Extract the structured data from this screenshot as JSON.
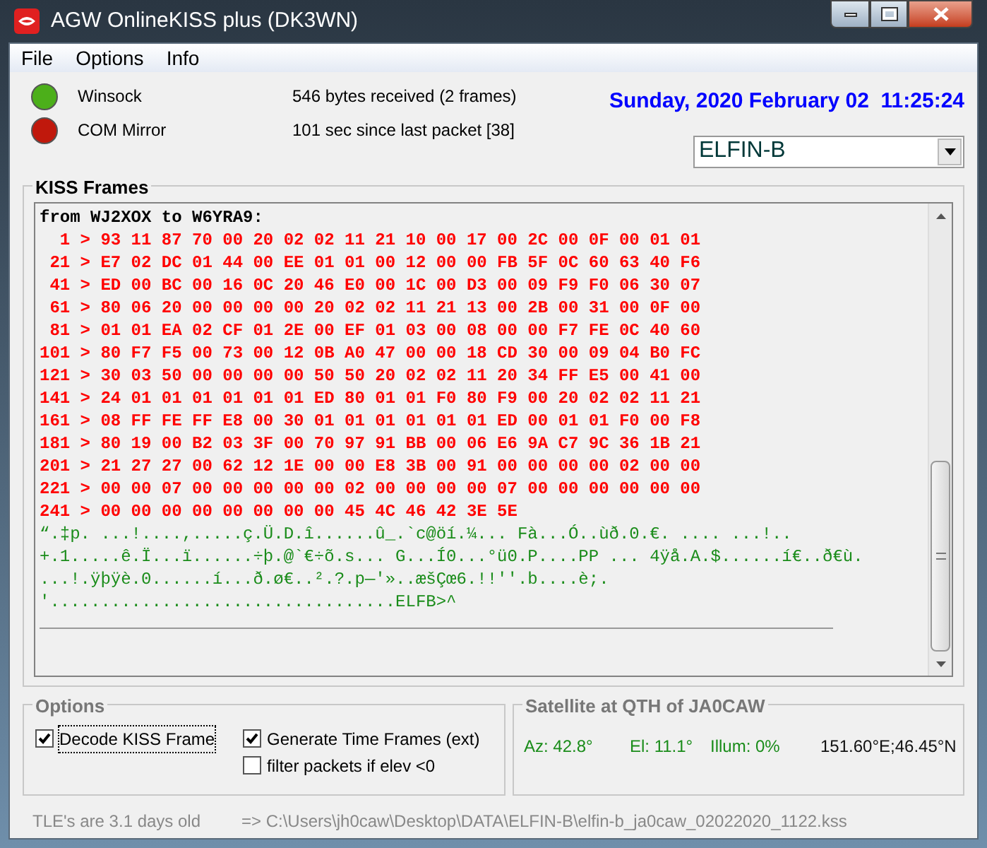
{
  "window": {
    "title": "AGW OnlineKISS plus (DK3WN)"
  },
  "menu": [
    "File",
    "Options",
    "Info"
  ],
  "status": [
    {
      "label": "Winsock",
      "color": "#4caf1a",
      "info": "546 bytes received (2 frames)"
    },
    {
      "label": "COM Mirror",
      "color": "#c0180c",
      "info": "101 sec since last packet [38]"
    }
  ],
  "datetime": "Sunday, 2020 February 02  11:25:24",
  "satellite_select": {
    "value": "ELFIN-B"
  },
  "kiss_frames": {
    "title": "KISS Frames",
    "lines": [
      {
        "kind": "header",
        "text": "from WJ2XOX to W6YRA9:"
      },
      {
        "kind": "hex",
        "text": "  1 > 93 11 87 70 00 20 02 02 11 21 10 00 17 00 2C 00 0F 00 01 01"
      },
      {
        "kind": "hex",
        "text": " 21 > E7 02 DC 01 44 00 EE 01 01 00 12 00 00 FB 5F 0C 60 63 40 F6"
      },
      {
        "kind": "hex",
        "text": " 41 > ED 00 BC 00 16 0C 20 46 E0 00 1C 00 D3 00 09 F9 F0 06 30 07"
      },
      {
        "kind": "hex",
        "text": " 61 > 80 06 20 00 00 00 00 20 02 02 11 21 13 00 2B 00 31 00 0F 00"
      },
      {
        "kind": "hex",
        "text": " 81 > 01 01 EA 02 CF 01 2E 00 EF 01 03 00 08 00 00 F7 FE 0C 40 60"
      },
      {
        "kind": "hex",
        "text": "101 > 80 F7 F5 00 73 00 12 0B A0 47 00 00 18 CD 30 00 09 04 B0 FC"
      },
      {
        "kind": "hex",
        "text": "121 > 30 03 50 00 00 00 00 50 50 20 02 02 11 20 34 FF E5 00 41 00"
      },
      {
        "kind": "hex",
        "text": "141 > 24 01 01 01 01 01 01 ED 80 01 01 F0 80 F9 00 20 02 02 11 21"
      },
      {
        "kind": "hex",
        "text": "161 > 08 FF FE FF E8 00 30 01 01 01 01 01 01 ED 00 01 01 F0 00 F8"
      },
      {
        "kind": "hex",
        "text": "181 > 80 19 00 B2 03 3F 00 70 97 91 BB 00 06 E6 9A C7 9C 36 1B 21"
      },
      {
        "kind": "hex",
        "text": "201 > 21 27 27 00 62 12 1E 00 00 E8 3B 00 91 00 00 00 00 02 00 00"
      },
      {
        "kind": "hex",
        "text": "221 > 00 00 07 00 00 00 00 00 02 00 00 00 00 07 00 00 00 00 00 00"
      },
      {
        "kind": "hex",
        "text": "241 > 00 00 00 00 00 00 00 00 45 4C 46 42 3E 5E"
      },
      {
        "kind": "ascii",
        "text": "“.‡p. ...!....,.....ç.Ü.D.î......û_.`c@öí.¼... Fà...Ó..ùð.0.€. .... ...!.."
      },
      {
        "kind": "ascii",
        "text": "+.1.....ê.Ï...ï......÷þ.@`€÷õ.s... G...Í0...°ü0.P....PP ... 4ÿå.A.$......í€..ð€ù."
      },
      {
        "kind": "ascii",
        "text": "...!.ÿþÿè.0......í...ð.ø€..².?.p—'»..æšÇœ6.!!''.b....è;."
      },
      {
        "kind": "ascii",
        "text": "'..................................ELFB>^"
      }
    ]
  },
  "options": {
    "title": "Options",
    "checkboxes": [
      {
        "label": "Decode KISS Frame",
        "checked": true,
        "focused": true
      },
      {
        "label": "Generate Time Frames (ext)",
        "checked": true,
        "focused": false
      },
      {
        "label": "filter packets if elev <0",
        "checked": false,
        "focused": false
      }
    ]
  },
  "satellite": {
    "title": "Satellite at QTH of JA0CAW",
    "az": "Az: 42.8°",
    "el": "El: 11.1°",
    "illum": "Illum: 0%",
    "position": "151.60°E;46.45°N"
  },
  "footer": {
    "tle_age": "TLE's are 3.1 days old",
    "file_path": "=> C:\\Users\\jh0caw\\Desktop\\DATA\\ELFIN-B\\elfin-b_ja0caw_02022020_1122.kss"
  }
}
